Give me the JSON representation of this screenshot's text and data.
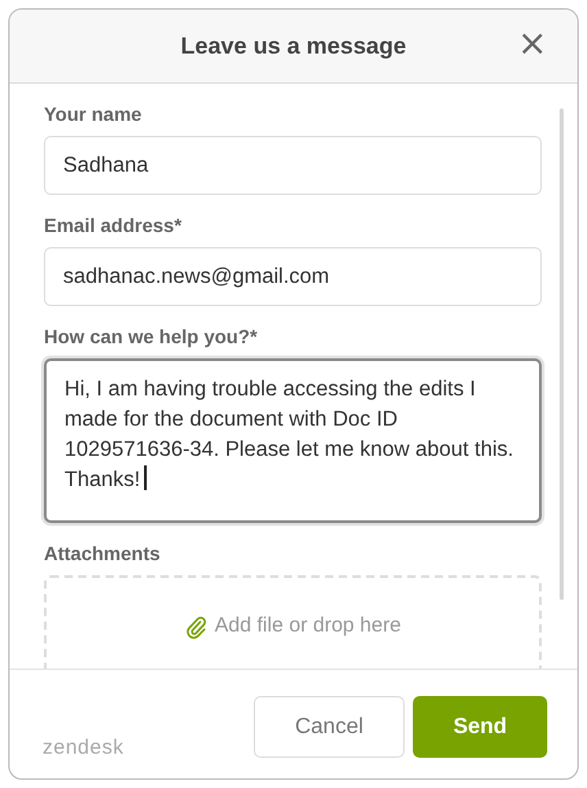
{
  "dialog": {
    "title": "Leave us a message",
    "close": "×"
  },
  "fields": [
    {
      "kind": "text",
      "label": "Your name",
      "value": "Sadhana",
      "focused": false
    },
    {
      "kind": "text",
      "label": "Email address*",
      "value": "sadhanac.news@gmail.com",
      "focused": false
    },
    {
      "kind": "textarea",
      "label": "How can we help you?*",
      "value": "Hi, I am having trouble accessing the edits I made for the document with Doc ID 1029571636-34. Please let me know about this. Thanks!",
      "focused": true
    },
    {
      "kind": "attachment",
      "label": "Attachments",
      "value": "Add file or drop here",
      "focused": false
    }
  ],
  "footer": {
    "brand": "zendesk",
    "buttons": [
      {
        "label": "Cancel",
        "kind": "secondary"
      },
      {
        "label": "Send",
        "kind": "primary"
      }
    ]
  }
}
